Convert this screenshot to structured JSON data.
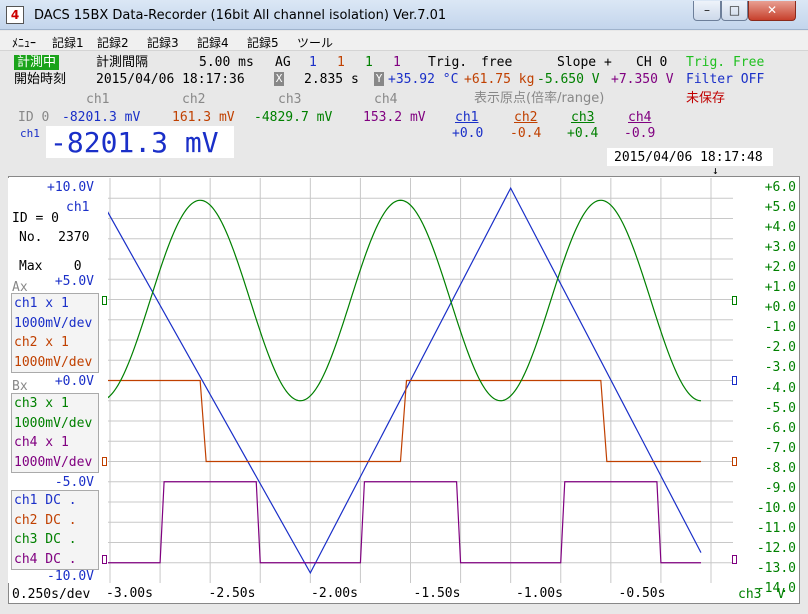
{
  "window": {
    "title": "DACS 15BX Data-Recorder (16bit All channel isolation) Ver.7.01",
    "icon_label": "4",
    "min_icon": "minimize-icon",
    "max_icon": "maximize-icon",
    "close_icon": "close-icon"
  },
  "menu": [
    "ﾒﾆｭｰ",
    "記録1",
    "記録2",
    "記録3",
    "記録4",
    "記録5",
    "ツール"
  ],
  "status": {
    "state_label": "計測中",
    "start_label": "開始時刻",
    "interval_label": "計測間隔",
    "interval_value": "5.00 ms",
    "ag_label": "AG",
    "ag_values": [
      "1",
      "1",
      "1",
      "1"
    ],
    "trig_label": "Trig.",
    "trig_value": "free",
    "slope_label": "Slope +",
    "ch_label": "CH 0",
    "trig_mode": "Trig. Free",
    "start_time": "2015/04/06 18:17:36",
    "x_cursor_icon": "X",
    "x_cursor_value": "2.835 s",
    "y_cursor_icon": "Y",
    "readings": [
      "+35.92 °C",
      "+61.75 kg",
      "-5.650 V",
      "+7.350 V"
    ],
    "filter": "Filter OFF"
  },
  "channels_header": {
    "names": [
      "ch1",
      "ch2",
      "ch3",
      "ch4"
    ],
    "origin_label": "表示原点(倍率/range)",
    "unsaved": "未保存",
    "id_label": "ID 0",
    "values": [
      "-8201.3 mV",
      "161.3 mV",
      "-4829.7 mV",
      "153.2 mV"
    ],
    "origins": [
      "+0.0",
      "-0.4",
      "+0.4",
      "-0.9"
    ]
  },
  "big": {
    "channel": "ch1",
    "value": "-8201.3 mV",
    "datetime": "2015/04/06 18:17:48"
  },
  "left_panel": {
    "top_value": "+10.0V",
    "ch_label": "ch1",
    "id_line": "ID = 0",
    "no_line": "No.  2370",
    "max_line": "Max    0",
    "ax_label": "Ax",
    "ax_value": "+5.0V",
    "bx_label": "Bx",
    "bx_value": "+0.0V",
    "m5_value": "-5.0V",
    "bottom_value": "-10.0V",
    "box_a": [
      "ch1 x   1",
      "1000mV/dev",
      "ch2 x   1",
      "1000mV/dev"
    ],
    "box_b": [
      "ch3 x   1",
      "1000mV/dev",
      "ch4 x   1",
      "1000mV/dev"
    ],
    "box_c": [
      "ch1 DC  .",
      "ch2 DC  .",
      "ch3 DC  .",
      "ch4 DC  ."
    ]
  },
  "right_axis": {
    "ticks": [
      "+6.0",
      "+5.0",
      "+4.0",
      "+3.0",
      "+2.0",
      "+1.0",
      "+0.0",
      "-1.0",
      "-2.0",
      "-3.0",
      "-4.0",
      "-5.0",
      "-6.0",
      "-7.0",
      "-8.0",
      "-9.0",
      "-10.0",
      "-11.0",
      "-12.0",
      "-13.0",
      "-14.0"
    ],
    "channel_label": "ch3  V"
  },
  "x_axis": {
    "scale": "0.250s/dev",
    "ticks": [
      "-3.00s",
      "-2.50s",
      "-2.00s",
      "-1.50s",
      "-1.00s",
      "-0.50s"
    ]
  },
  "colors": {
    "ch1": "#1a2fc8",
    "ch2": "#c04000",
    "ch3": "#008000",
    "ch4": "#800080",
    "grid": "#c8c8c8",
    "state_badge": "#1aa31a"
  },
  "chart_data": {
    "type": "line",
    "x_range": [
      -3.0,
      0.0
    ],
    "x_tick_step": 0.25,
    "y_range": [
      -14.0,
      6.0
    ],
    "series": [
      {
        "name": "ch1",
        "x": [
          -3.05,
          -2.0,
          -1.0,
          -0.05
        ],
        "y": [
          5.0,
          -13.5,
          5.5,
          -12.5
        ]
      },
      {
        "name": "ch2",
        "x": [
          -3.05,
          -2.55,
          -2.52,
          -1.55,
          -1.52,
          -0.55,
          -0.52,
          -0.05
        ],
        "y": [
          -4.0,
          -4.0,
          -8.0,
          -8.0,
          -4.0,
          -4.0,
          -8.0,
          -8.0
        ]
      },
      {
        "name": "ch3",
        "x": [
          -3.05,
          -2.8,
          -2.55,
          -2.3,
          -2.05,
          -1.8,
          -1.55,
          -1.3,
          -1.05,
          -0.8,
          -0.55,
          -0.3,
          -0.05
        ],
        "y": [
          -5.0,
          1.0,
          4.9,
          1.0,
          -5.0,
          1.0,
          4.9,
          1.0,
          -5.0,
          1.0,
          4.9,
          1.0,
          -5.0
        ]
      },
      {
        "name": "ch4",
        "x": [
          -3.05,
          -2.75,
          -2.73,
          -2.27,
          -2.25,
          -1.75,
          -1.73,
          -1.27,
          -1.25,
          -0.75,
          -0.73,
          -0.27,
          -0.25,
          -0.05
        ],
        "y": [
          -13.0,
          -13.0,
          -9.0,
          -9.0,
          -13.0,
          -13.0,
          -9.0,
          -9.0,
          -13.0,
          -13.0,
          -9.0,
          -9.0,
          -13.0,
          -13.0
        ]
      }
    ]
  }
}
